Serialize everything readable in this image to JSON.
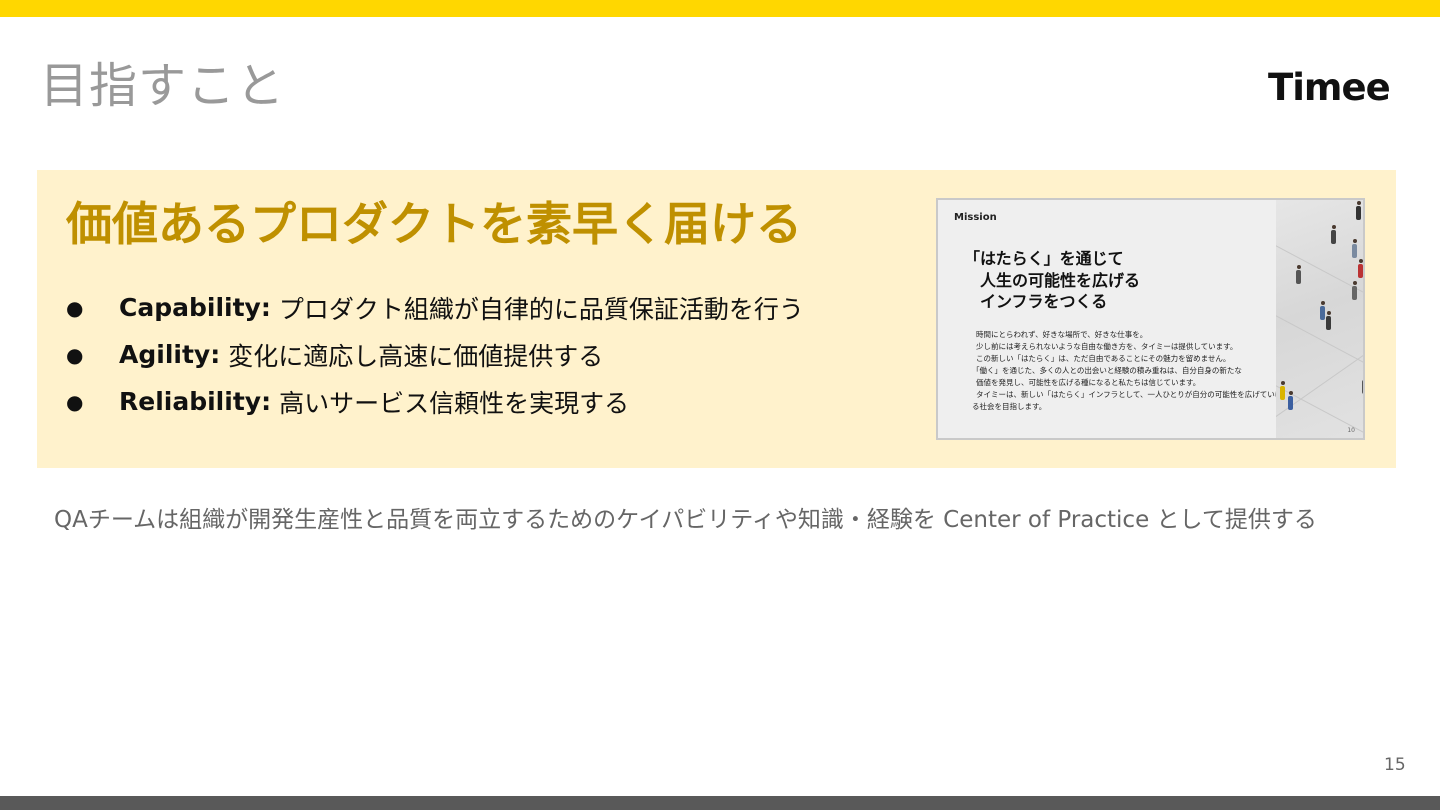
{
  "title": "目指すこと",
  "logo": "Timee",
  "headline": "価値あるプロダクトを素早く届ける",
  "bullets": [
    {
      "key": "Capability:",
      "text": "プロダクト組織が自律的に品質保証活動を行う"
    },
    {
      "key": "Agility:",
      "text": "変化に適応し高速に価値提供する"
    },
    {
      "key": "Reliability:",
      "text": "高いサービス信頼性を実現する"
    }
  ],
  "bullet_symbol": "●",
  "thumbnail": {
    "label": "Mission",
    "heading": [
      "「はたらく」を通じて",
      "人生の可能性を広げる",
      "インフラをつくる"
    ],
    "body": [
      "時間にとらわれず、好きな場所で、好きな仕事を。",
      "少し前には考えられないような自由な働き方を、タイミーは提供しています。",
      "この新しい「はたらく」は、ただ自由であることにその魅力を留めません。",
      "「働く」を通じた、多くの人との出会いと経験の積み重ねは、自分自身の新たな",
      "価値を発見し、可能性を広げる種になると私たちは信じています。",
      "タイミーは、新しい「はたらく」インフラとして、一人ひとりが自分の可能性を広げていけ",
      "る社会を目指します。"
    ],
    "page": "10"
  },
  "subtext": "QAチームは組織が開発生産性と品質を両立するためのケイパビリティや知識・経験を Center of Practice として提供する",
  "page_number": "15",
  "colors": {
    "top_bar": "#ffd700",
    "bottom_bar": "#595959",
    "highlight_background": "#fff2cc",
    "headline": "#bf9000",
    "title": "#999999"
  }
}
